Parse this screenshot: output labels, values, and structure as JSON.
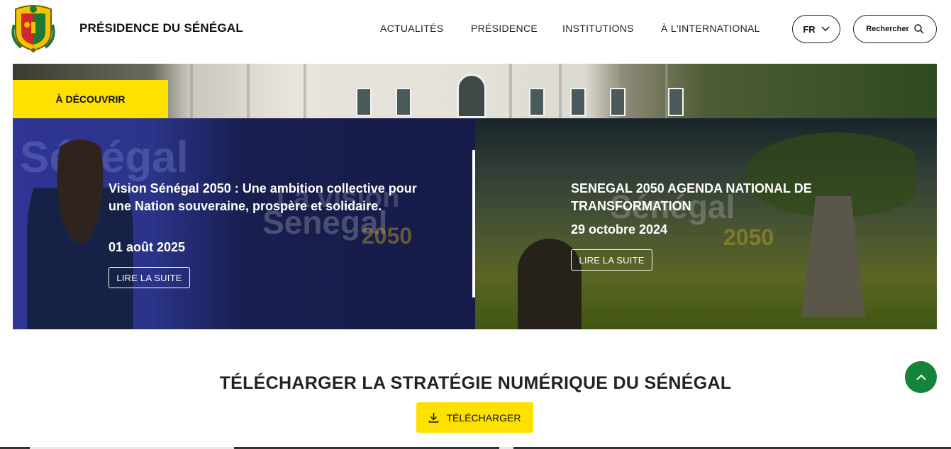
{
  "header": {
    "site_title": "PRÉSIDENCE DU SÉNÉGAL",
    "logo_icon": "senegal-coat-of-arms",
    "nav": [
      {
        "label": "ACTUALITÉS"
      },
      {
        "label": "PRÉSIDENCE"
      },
      {
        "label": "INSTITUTIONS"
      },
      {
        "label": "À L'INTERNATIONAL"
      }
    ],
    "language": {
      "label": "FR",
      "icon": "chevron-down-icon"
    },
    "search": {
      "label": "Rechercher",
      "icon": "search-icon"
    }
  },
  "hero": {
    "badge": "À DÉCOUVRIR",
    "cards": [
      {
        "title": "Vision Sénégal 2050 : Une ambition collective pour une Nation souveraine, prospère et solidaire.",
        "date": "01 août 2025",
        "button": "LIRE LA SUITE",
        "watermark_top": "Sénégal",
        "watermark_mid": "La vision",
        "watermark_main": "Senegal",
        "watermark_year": "2050"
      },
      {
        "title": "SENEGAL 2050 AGENDA NATIONAL DE TRANSFORMATION",
        "date": "29 octobre 2024",
        "button": "LIRE LA SUITE",
        "watermark_main": "Sénégal",
        "watermark_year": "2050"
      }
    ]
  },
  "download": {
    "title": "TÉLÉCHARGER LA STRATÉGIE NUMÉRIQUE DU SÉNÉGAL",
    "button": "TÉLÉCHARGER",
    "icon": "download-icon"
  },
  "scroll_top": {
    "icon": "chevron-up-icon"
  },
  "colors": {
    "accent_yellow": "#ffe100",
    "green": "#13843a",
    "text_dark": "#111111"
  }
}
